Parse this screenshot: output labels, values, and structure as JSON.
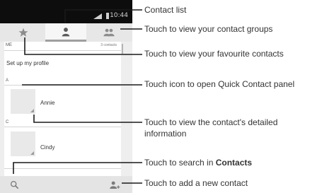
{
  "status_bar": {
    "time": "10:44"
  },
  "tabs": [
    {
      "name": "favourites",
      "icon": "star-icon"
    },
    {
      "name": "contacts",
      "icon": "person-icon"
    },
    {
      "name": "groups",
      "icon": "group-icon"
    }
  ],
  "list": {
    "me_header": "ME",
    "contact_count": "3 contacts",
    "profile_label": "Set up my profile",
    "sections": [
      {
        "letter": "A",
        "contact": "Annie"
      },
      {
        "letter": "C",
        "contact": "Cindy"
      }
    ]
  },
  "bottom_bar": {
    "search_icon": "search-icon",
    "add_icon": "add-contact-icon"
  },
  "callouts": {
    "contact_list": "Contact list",
    "groups": "Touch to view your contact groups",
    "favourites": "Touch to view your favourite contacts",
    "quick_contact": "Touch icon to open Quick Contact panel",
    "details_line1": "Touch to view the contact's detailed",
    "details_line2": "information",
    "search_prefix": "Touch to search in ",
    "search_bold": "Contacts",
    "add_contact": "Touch to add a new contact"
  },
  "colors": {
    "callout_line": "#1a1a1a",
    "status_bar": "#0d0d0d",
    "selected_tab_underline": "#9f9f9f"
  }
}
